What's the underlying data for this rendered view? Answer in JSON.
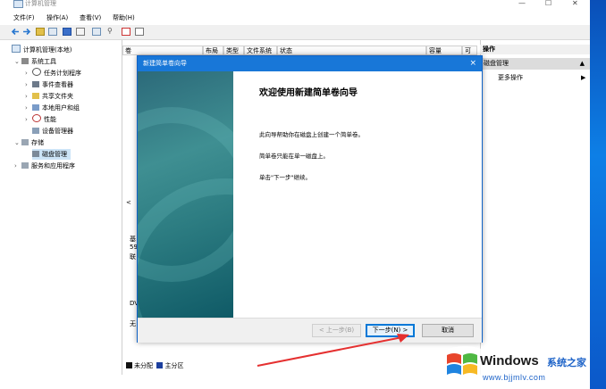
{
  "window": {
    "title": "计算机管理"
  },
  "menu": [
    "文件(F)",
    "操作(A)",
    "查看(V)",
    "帮助(H)"
  ],
  "tree": {
    "root": "计算机管理(本地)",
    "system_tools": "系统工具",
    "items": [
      "任务计划程序",
      "事件查看器",
      "共享文件夹",
      "本地用户和组",
      "性能",
      "设备管理器"
    ],
    "storage": "存储",
    "disk_mgmt": "磁盘管理",
    "services": "服务和应用程序"
  },
  "columns": [
    "卷",
    "布局",
    "类型",
    "文件系统",
    "状态",
    "容量",
    "可"
  ],
  "center": {
    "left_chars": [
      "基",
      "59",
      "联",
      "DV",
      "无"
    ],
    "scroll_left": "<"
  },
  "legend": {
    "unallocated": "未分配",
    "primary": "主分区"
  },
  "actions": {
    "header": "操作",
    "section": "磁盘管理",
    "more": "更多操作",
    "section_arrow": "▲",
    "more_arrow": "▶"
  },
  "dialog": {
    "title": "新建简单卷向导",
    "close": "×",
    "heading": "欢迎使用新建简单卷向导",
    "line1": "此向导帮助你在磁盘上创建一个简单卷。",
    "line2": "简单卷只能在单一磁盘上。",
    "line3": "单击\"下一步\"继续。",
    "back": "< 上一步(B)",
    "next": "下一步(N) >",
    "cancel": "取消"
  },
  "watermark": {
    "brand": "Windows",
    "cn": "系统之家",
    "url": "www.bjjmlv.com"
  },
  "colors": {
    "accent": "#1877d8",
    "arrow": "#e53030",
    "banner": "#2d7d82"
  }
}
